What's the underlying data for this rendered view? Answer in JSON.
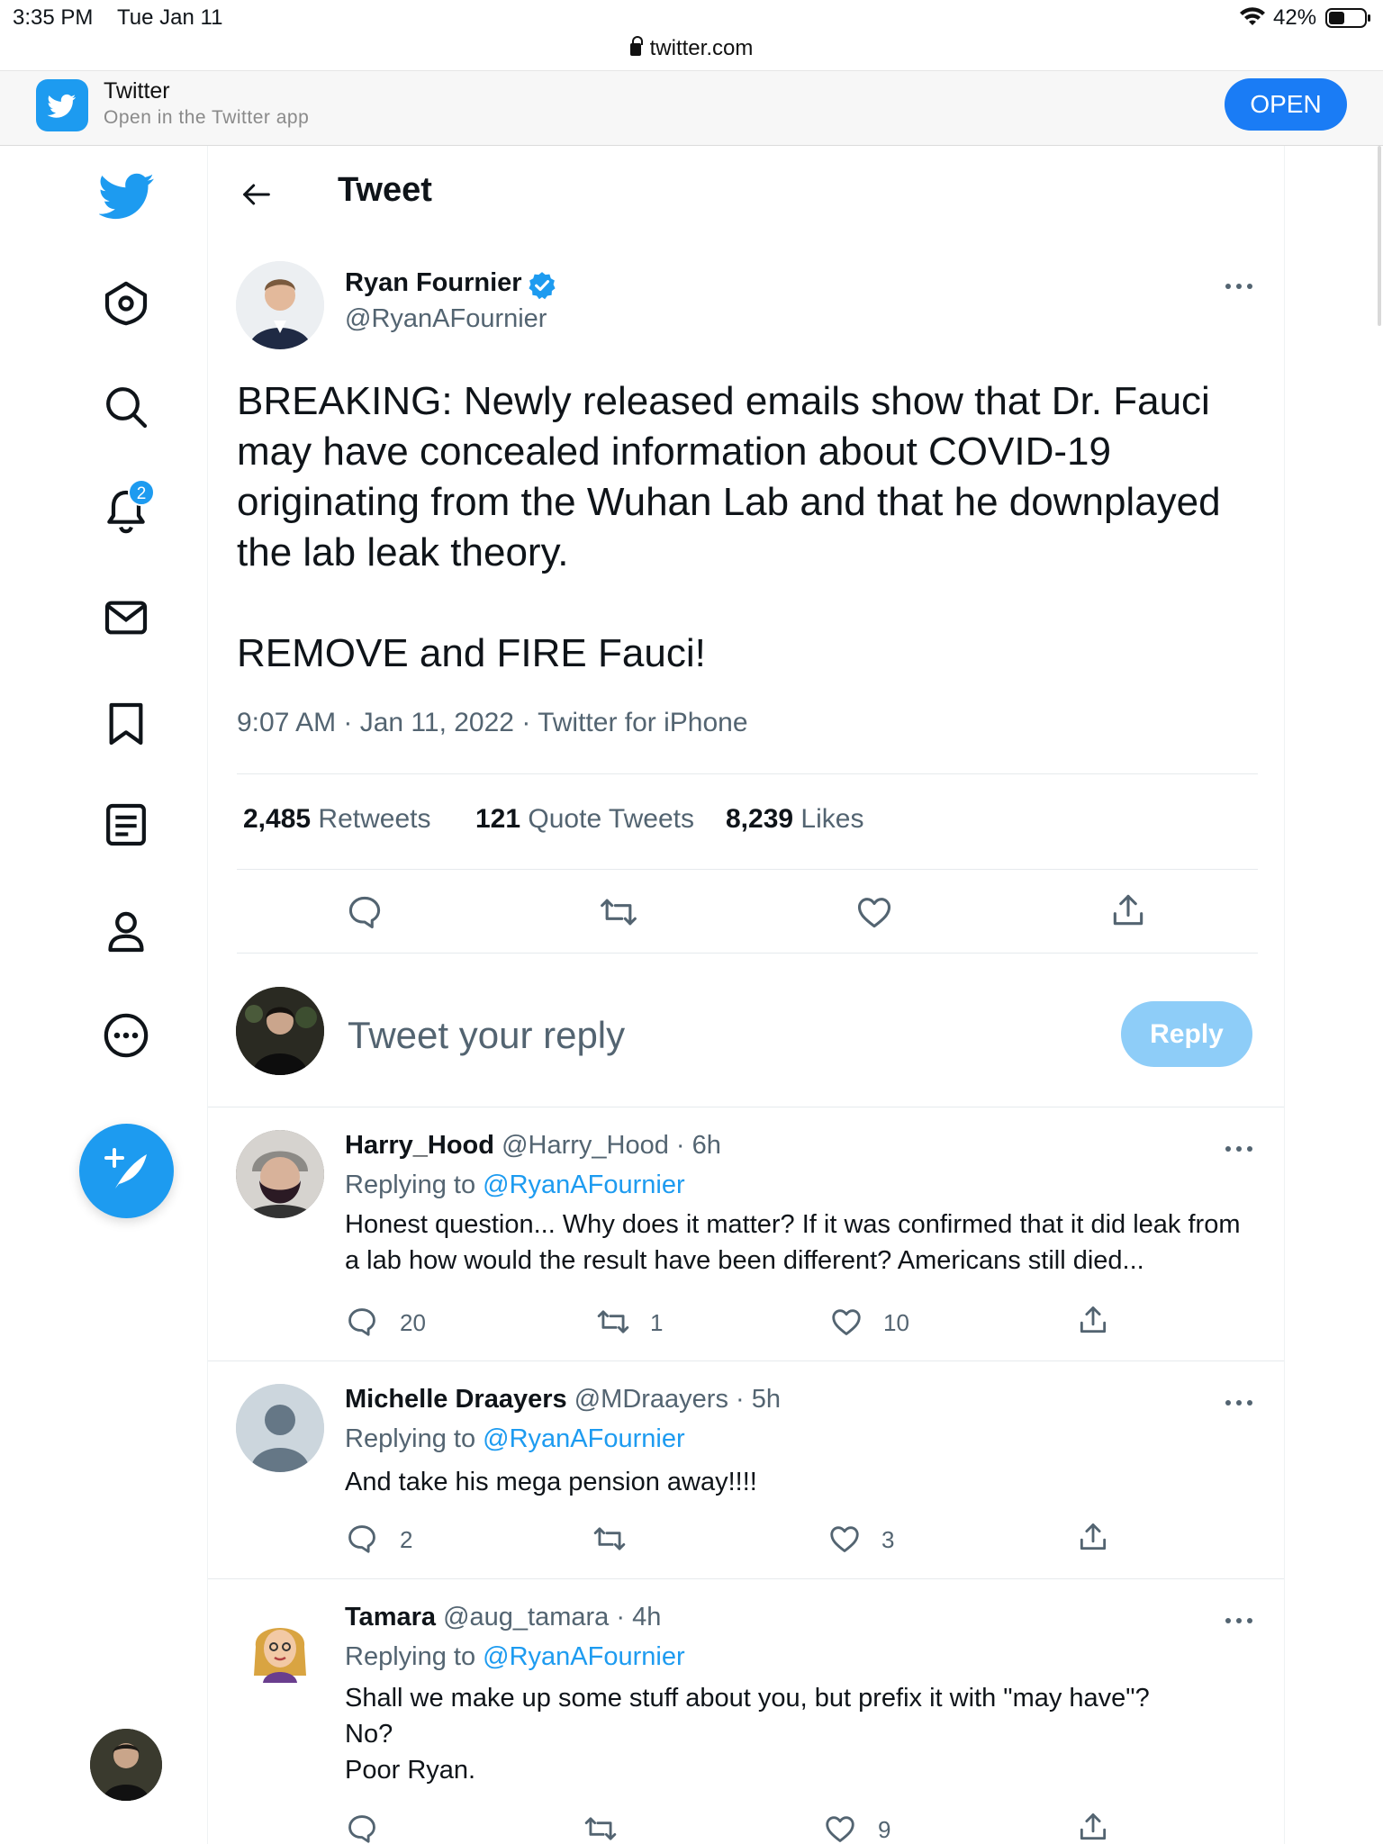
{
  "status_bar": {
    "time": "3:35 PM",
    "date": "Tue Jan 11",
    "battery": "42%",
    "url": "twitter.com"
  },
  "app_banner": {
    "app_name": "Twitter",
    "subtitle": "Open in the Twitter app",
    "open_label": "OPEN"
  },
  "sidebar": {
    "items": [
      "twitter-logo",
      "home",
      "explore",
      "notifications",
      "messages",
      "bookmarks",
      "lists",
      "profile",
      "more"
    ],
    "notification_count": "2"
  },
  "header": {
    "title": "Tweet"
  },
  "tweet": {
    "author_name": "Ryan Fournier",
    "author_handle": "@RyanAFournier",
    "text": "BREAKING: Newly released emails show that Dr. Fauci may have concealed information about COVID-19 originating from the Wuhan Lab and that he downplayed the lab leak theory.\n\nREMOVE and FIRE Fauci!",
    "meta": "9:07 AM · Jan 11, 2022 · Twitter for iPhone",
    "retweets_count": "2,485",
    "retweets_label": "Retweets",
    "quotes_count": "121",
    "quotes_label": "Quote Tweets",
    "likes_count": "8,239",
    "likes_label": "Likes"
  },
  "composer": {
    "placeholder": "Tweet your reply",
    "reply_label": "Reply"
  },
  "replies": [
    {
      "name": "Harry_Hood",
      "handle_time": "@Harry_Hood · 6h",
      "replying_prefix": "Replying to",
      "replying_to": "@RyanAFournier",
      "text": "Honest question... Why does it matter? If it was confirmed that it did leak from a lab how would the result have been different? Americans still died...",
      "replies": "20",
      "retweets": "1",
      "likes": "10"
    },
    {
      "name": "Michelle Draayers",
      "handle_time": "@MDraayers · 5h",
      "replying_prefix": "Replying to",
      "replying_to": "@RyanAFournier",
      "text": "And take his mega pension away!!!!",
      "replies": "2",
      "retweets": "",
      "likes": "3"
    },
    {
      "name": "Tamara",
      "handle_time": "@aug_tamara · 4h",
      "replying_prefix": "Replying to",
      "replying_to": "@RyanAFournier",
      "text": "Shall we make up some stuff about you, but prefix it with \"may have\"?\nNo?\nPoor Ryan.",
      "replies": "",
      "retweets": "",
      "likes": "9"
    }
  ],
  "colors": {
    "brand": "#1d9bf0",
    "text_primary": "#0f1419",
    "text_secondary": "#536471",
    "reply_button_disabled": "#8ecdf8",
    "open_button": "#1a7cf5"
  }
}
